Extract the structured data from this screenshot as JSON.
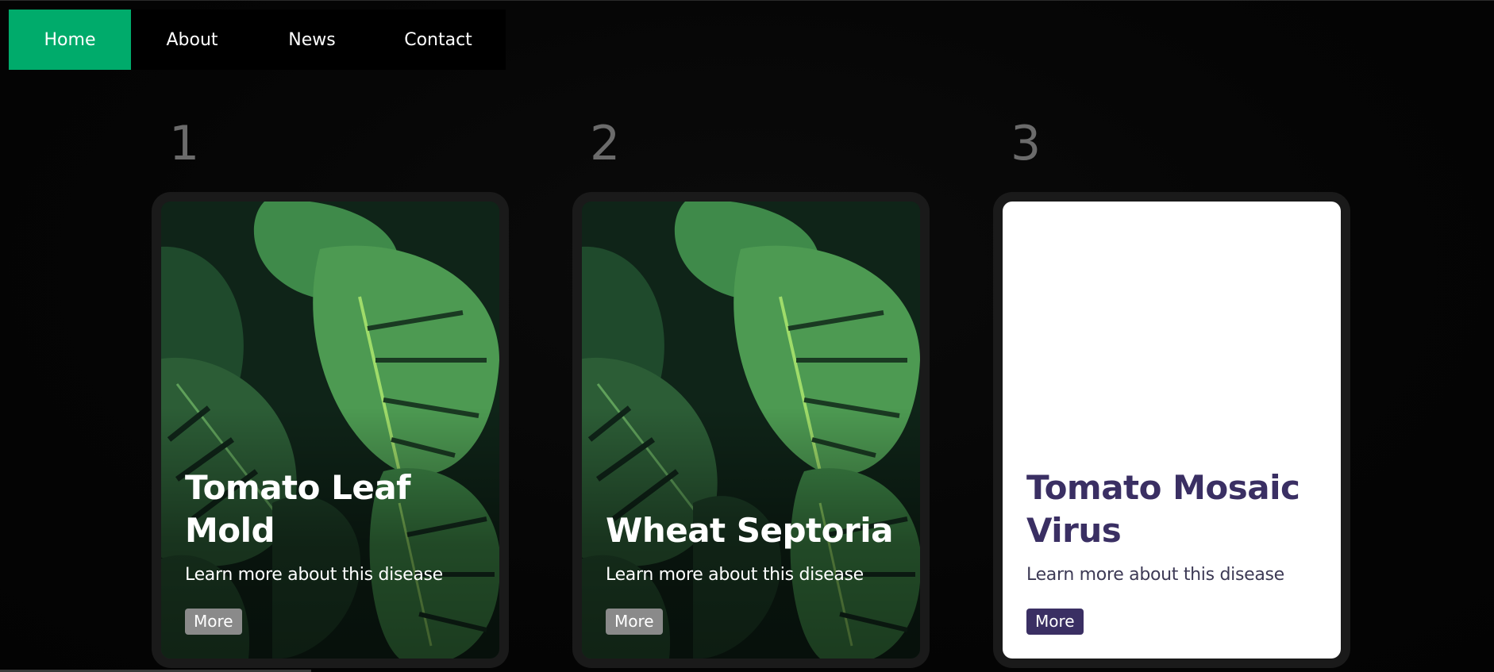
{
  "nav": {
    "items": [
      {
        "label": "Home",
        "active": true
      },
      {
        "label": "About",
        "active": false
      },
      {
        "label": "News",
        "active": false
      },
      {
        "label": "Contact",
        "active": false
      }
    ],
    "active_color": "#00ab6b"
  },
  "cards": [
    {
      "number": "1",
      "title": "Tomato Leaf Mold",
      "description": "Learn more about this disease",
      "button_label": "More",
      "background": "monstera-leaves-image"
    },
    {
      "number": "2",
      "title": "Wheat Septoria",
      "description": "Learn more about this disease",
      "button_label": "More",
      "background": "monstera-leaves-image"
    },
    {
      "number": "3",
      "title": "Tomato Mosaic Virus",
      "description": "Learn more about this disease",
      "button_label": "More",
      "background": "white"
    }
  ],
  "colors": {
    "page_background": "#050505",
    "card_frame": "#1a1a1a",
    "white_card_text": "#3a2f63",
    "button_gray": "#8a8a8a"
  }
}
